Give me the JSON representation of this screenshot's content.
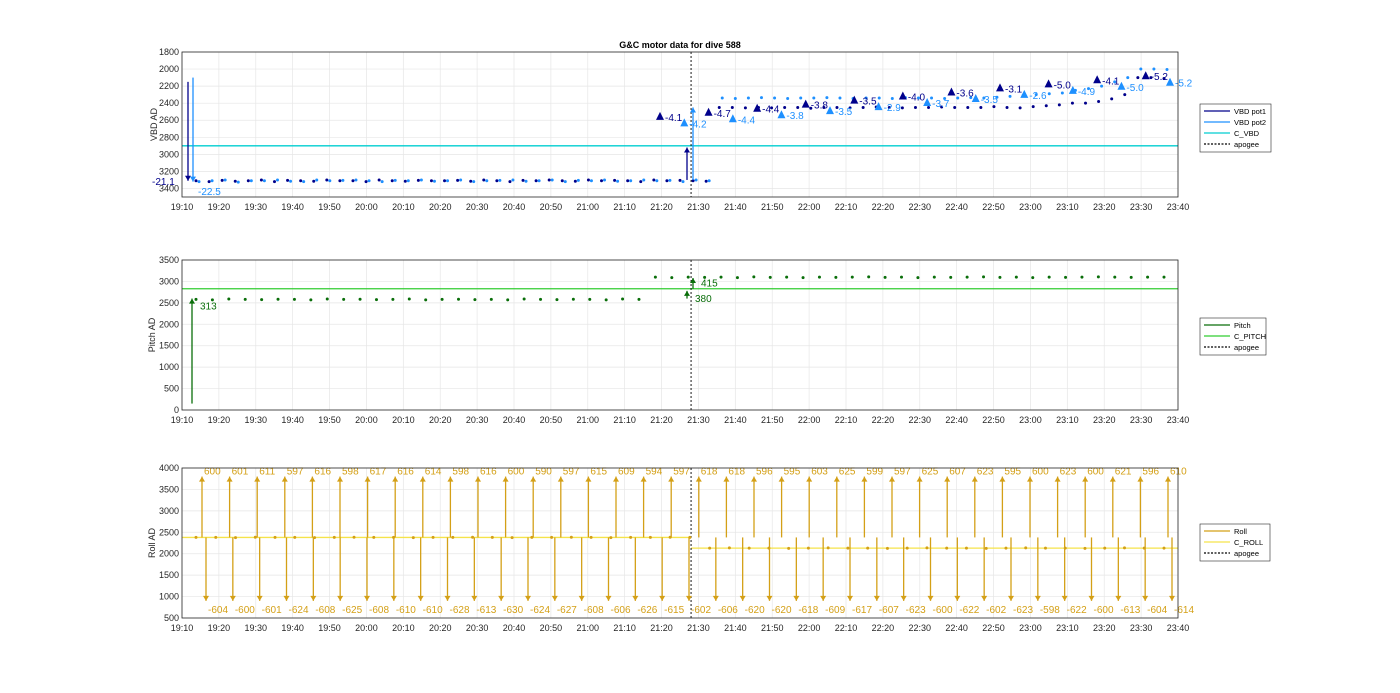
{
  "figure_title": "G&C motor data for dive 588",
  "colors": {
    "vbd_pot1": "#00008b",
    "vbd_pot2": "#1e90ff",
    "c_vbd": "#00ced1",
    "pitch": "#0a6e0a",
    "c_pitch": "#32cd32",
    "roll": "#d4a017",
    "c_roll": "#f5e34a",
    "apogee": "#000000",
    "grid": "#e6e6e6"
  },
  "chart_data": [
    {
      "type": "line",
      "panel": "vbd",
      "title": "G&C motor data for dive 588",
      "ylabel": "VBD AD",
      "xlabel": "",
      "ylim": [
        1800,
        3500
      ],
      "y_reversed": true,
      "yticks": [
        1800,
        2000,
        2200,
        2400,
        2600,
        2800,
        3000,
        3200,
        3400
      ],
      "xticks": [
        "19:10",
        "19:20",
        "19:30",
        "19:40",
        "19:50",
        "20:00",
        "20:10",
        "20:20",
        "20:30",
        "20:40",
        "20:50",
        "21:00",
        "21:10",
        "21:20",
        "21:30",
        "21:40",
        "21:50",
        "22:00",
        "22:10",
        "22:20",
        "22:30",
        "22:40",
        "22:50",
        "23:00",
        "23:10",
        "23:20",
        "23:30",
        "23:40"
      ],
      "grid": true,
      "legend": "right",
      "legend_entries": [
        "VBD pot1",
        "VBD pot2",
        "C_VBD",
        "apogee"
      ],
      "series": [
        {
          "name": "VBD pot1",
          "values": [
            3310,
            3320,
            3305,
            3315,
            3310,
            3300,
            3320,
            3305,
            3310,
            3315,
            3300,
            3310,
            3310,
            3320,
            3300,
            3310,
            3315,
            3305,
            3310,
            3310,
            3305,
            3315,
            3300,
            3310,
            3320,
            3305,
            3310,
            3300,
            3310,
            3315,
            3300,
            3310,
            3305,
            3310,
            3320,
            3300,
            3310,
            3305,
            3310,
            3315,
            2450,
            2450,
            2455,
            2450,
            2455,
            2450,
            2450,
            2460,
            2450,
            2450,
            2455,
            2450,
            2445,
            2450,
            2455,
            2450,
            2450,
            2445,
            2450,
            2450,
            2450,
            2440,
            2450,
            2455,
            2440,
            2430,
            2420,
            2400,
            2400,
            2380,
            2350,
            2300,
            2100,
            2100,
            2110
          ]
        },
        {
          "name": "VBD pot2",
          "values": [
            3320,
            3310,
            3300,
            3325,
            3310,
            3310,
            3300,
            3315,
            3320,
            3300,
            3310,
            3305,
            3300,
            3310,
            3320,
            3305,
            3310,
            3300,
            3315,
            3310,
            3300,
            3320,
            3310,
            3305,
            3300,
            3315,
            3310,
            3300,
            3320,
            3305,
            3310,
            3300,
            3315,
            3310,
            3300,
            3310,
            3305,
            3320,
            3300,
            3310,
            2340,
            2345,
            2340,
            2335,
            2340,
            2345,
            2340,
            2340,
            2335,
            2340,
            2345,
            2340,
            2340,
            2345,
            2335,
            2340,
            2340,
            2345,
            2340,
            2335,
            2340,
            2330,
            2320,
            2310,
            2300,
            2290,
            2280,
            2250,
            2230,
            2200,
            2150,
            2100,
            2000,
            2000,
            2005
          ]
        },
        {
          "name": "C_VBD",
          "values": [
            2900,
            2900
          ]
        }
      ],
      "apogee_time": "21:28",
      "annotations": [
        "-21.1",
        "-22.5",
        "-4.1",
        "-4.2",
        "-4.7",
        "-4.4",
        "-4.4",
        "-3.8",
        "-3.8",
        "-3.5",
        "-3.5",
        "-2.9",
        "-4.0",
        "-3.7",
        "-3.6",
        "-3.5",
        "-3.1",
        "-2.6",
        "-5.0",
        "-4.9",
        "-4.1",
        "-5.0",
        "-5.2",
        "-5.2"
      ]
    },
    {
      "type": "line",
      "panel": "pitch",
      "title": "",
      "ylabel": "Pitch AD",
      "xlabel": "",
      "ylim": [
        0,
        3500
      ],
      "yticks": [
        0,
        500,
        1000,
        1500,
        2000,
        2500,
        3000,
        3500
      ],
      "xticks": [
        "19:10",
        "19:20",
        "19:30",
        "19:40",
        "19:50",
        "20:00",
        "20:10",
        "20:20",
        "20:30",
        "20:40",
        "20:50",
        "21:00",
        "21:10",
        "21:20",
        "21:30",
        "21:40",
        "21:50",
        "22:00",
        "22:10",
        "22:20",
        "22:30",
        "22:40",
        "22:50",
        "23:00",
        "23:10",
        "23:20",
        "23:30",
        "23:40"
      ],
      "grid": true,
      "legend": "right",
      "legend_entries": [
        "Pitch",
        "C_PITCH",
        "apogee"
      ],
      "series": [
        {
          "name": "Pitch",
          "values": [
            2580,
            2570,
            2590,
            2580,
            2575,
            2585,
            2580,
            2570,
            2590,
            2580,
            2585,
            2575,
            2580,
            2590,
            2570,
            2580,
            2585,
            2575,
            2580,
            2570,
            2590,
            2580,
            2575,
            2585,
            2580,
            2570,
            2590,
            2580,
            3100,
            3090,
            3100,
            3095,
            3100,
            3090,
            3105,
            3095,
            3100,
            3090,
            3100,
            3095,
            3100,
            3105,
            3095,
            3100,
            3090,
            3100,
            3095,
            3100,
            3105,
            3095,
            3100,
            3090,
            3100,
            3095,
            3100,
            3105,
            3100,
            3095,
            3100,
            3100
          ]
        },
        {
          "name": "C_PITCH",
          "values": [
            2830,
            2830
          ]
        }
      ],
      "apogee_time": "21:28",
      "annotations": [
        "313",
        "380",
        "415"
      ]
    },
    {
      "type": "line",
      "panel": "roll",
      "title": "",
      "ylabel": "Roll AD",
      "xlabel": "",
      "ylim": [
        500,
        4000
      ],
      "yticks": [
        500,
        1000,
        1500,
        2000,
        2500,
        3000,
        3500,
        4000
      ],
      "xticks": [
        "19:10",
        "19:20",
        "19:30",
        "19:40",
        "19:50",
        "20:00",
        "20:10",
        "20:20",
        "20:30",
        "20:40",
        "20:50",
        "21:00",
        "21:10",
        "21:20",
        "21:30",
        "21:40",
        "21:50",
        "22:00",
        "22:10",
        "22:20",
        "22:30",
        "22:40",
        "22:50",
        "23:00",
        "23:10",
        "23:20",
        "23:30",
        "23:40"
      ],
      "grid": true,
      "legend": "right",
      "legend_entries": [
        "Roll",
        "C_ROLL",
        "apogee"
      ],
      "series": [
        {
          "name": "Roll",
          "values": [
            2380,
            2380,
            2375,
            2385,
            2380,
            2380,
            2375,
            2380,
            2385,
            2380,
            2380,
            2375,
            2380,
            2380,
            2385,
            2380,
            2375,
            2380,
            2380,
            2385,
            2380,
            2375,
            2380,
            2380,
            2385,
            2380,
            2130,
            2135,
            2130,
            2130,
            2125,
            2130,
            2135,
            2130,
            2130,
            2125,
            2130,
            2135,
            2130,
            2130,
            2125,
            2130,
            2135,
            2130,
            2130,
            2125,
            2130,
            2135,
            2130,
            2130
          ]
        },
        {
          "name": "C_ROLL",
          "values": [
            2380,
            2130
          ]
        }
      ],
      "apogee_time": "21:28",
      "annotations_up": [
        "600",
        "601",
        "611",
        "597",
        "616",
        "598",
        "617",
        "616",
        "614",
        "598",
        "616",
        "600",
        "590",
        "597",
        "615",
        "609",
        "594",
        "597",
        "618",
        "618",
        "596",
        "595",
        "603",
        "625",
        "599",
        "597",
        "625",
        "607",
        "623",
        "595",
        "600",
        "623",
        "600",
        "621",
        "596",
        "610"
      ],
      "annotations_down": [
        "-604",
        "-600",
        "-601",
        "-624",
        "-608",
        "-625",
        "-608",
        "-610",
        "-610",
        "-628",
        "-613",
        "-630",
        "-624",
        "-627",
        "-608",
        "-606",
        "-626",
        "-615",
        "-602",
        "-606",
        "-620",
        "-620",
        "-618",
        "-609",
        "-617",
        "-607",
        "-623",
        "-600",
        "-622",
        "-602",
        "-623",
        "-598",
        "-622",
        "-600",
        "-613",
        "-604",
        "-614"
      ]
    }
  ]
}
